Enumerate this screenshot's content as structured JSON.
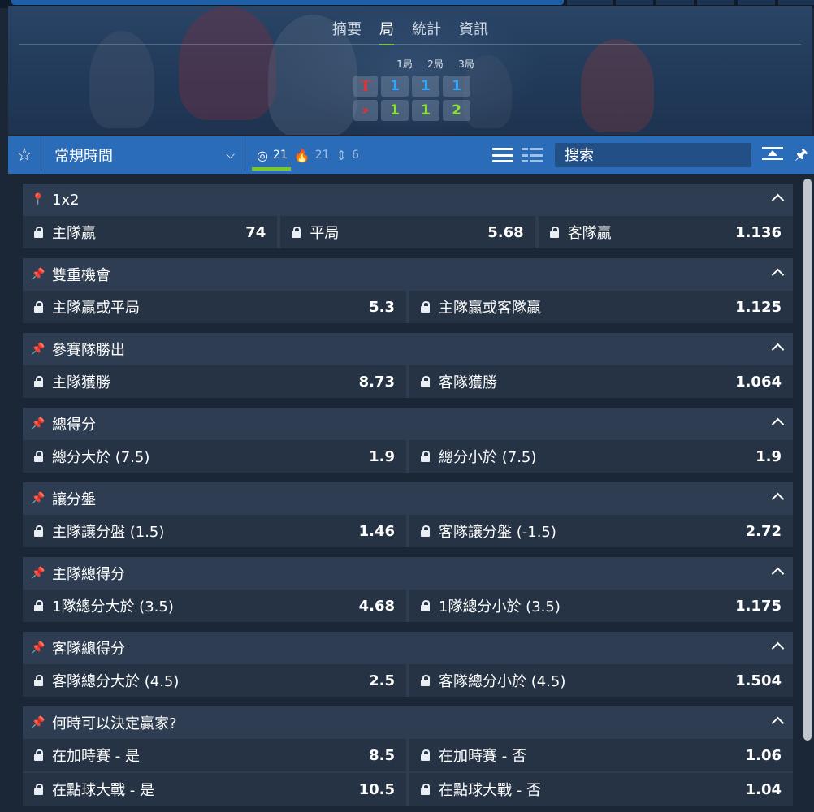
{
  "hero": {
    "tabs": [
      "摘要",
      "局",
      "統計",
      "資訊"
    ],
    "active_tab": "局",
    "score_headers": [
      "1局",
      "2局",
      "3局"
    ],
    "teams": [
      {
        "logo": "T",
        "scores": [
          "1",
          "1",
          "1"
        ]
      },
      {
        "logo": "≯",
        "scores": [
          "1",
          "1",
          "2"
        ]
      }
    ]
  },
  "toolbar": {
    "period_label": "常規時間",
    "counts": {
      "all": "21",
      "popular": "21",
      "other": "6"
    },
    "search_placeholder": "搜索"
  },
  "markets": [
    {
      "title": "1x2",
      "pinned": true,
      "rows": [
        [
          {
            "label": "主隊贏",
            "odds": "74"
          },
          {
            "label": "平局",
            "odds": "5.68"
          },
          {
            "label": "客隊贏",
            "odds": "1.136"
          }
        ]
      ]
    },
    {
      "title": "雙重機會",
      "pinned": false,
      "rows": [
        [
          {
            "label": "主隊贏或平局",
            "odds": "5.3"
          },
          {
            "label": "主隊贏或客隊贏",
            "odds": "1.125"
          }
        ]
      ]
    },
    {
      "title": "參賽隊勝出",
      "pinned": false,
      "rows": [
        [
          {
            "label": "主隊獲勝",
            "odds": "8.73"
          },
          {
            "label": "客隊獲勝",
            "odds": "1.064"
          }
        ]
      ]
    },
    {
      "title": "總得分",
      "pinned": false,
      "rows": [
        [
          {
            "label": "總分大於 (7.5)",
            "odds": "1.9"
          },
          {
            "label": "總分小於 (7.5)",
            "odds": "1.9"
          }
        ]
      ]
    },
    {
      "title": "讓分盤",
      "pinned": false,
      "rows": [
        [
          {
            "label": "主隊讓分盤 (1.5)",
            "odds": "1.46"
          },
          {
            "label": "客隊讓分盤 (-1.5)",
            "odds": "2.72"
          }
        ]
      ]
    },
    {
      "title": "主隊總得分",
      "pinned": false,
      "rows": [
        [
          {
            "label": "1隊總分大於 (3.5)",
            "odds": "4.68"
          },
          {
            "label": "1隊總分小於 (3.5)",
            "odds": "1.175"
          }
        ]
      ]
    },
    {
      "title": "客隊總得分",
      "pinned": false,
      "rows": [
        [
          {
            "label": "客隊總分大於 (4.5)",
            "odds": "2.5"
          },
          {
            "label": "客隊總分小於 (4.5)",
            "odds": "1.504"
          }
        ]
      ]
    },
    {
      "title": "何時可以決定贏家?",
      "pinned": false,
      "rows": [
        [
          {
            "label": "在加時賽 - 是",
            "odds": "8.5"
          },
          {
            "label": "在加時賽 - 否",
            "odds": "1.06"
          }
        ],
        [
          {
            "label": "在點球大戰 - 是",
            "odds": "10.5"
          },
          {
            "label": "在點球大戰 - 否",
            "odds": "1.04"
          }
        ]
      ]
    }
  ],
  "colors": {
    "accent": "#2b6cb8",
    "active_underline": "#7bc72c",
    "score_blue": "#2ea7ff",
    "score_green": "#8fe03a"
  },
  "icons": [
    "star-icon",
    "chevron-down-icon",
    "target-icon",
    "fire-icon",
    "sort-icon",
    "list-view-icon",
    "grid-view-icon",
    "collapse-all-icon",
    "pin-icon",
    "lock-icon",
    "caret-up-icon"
  ]
}
